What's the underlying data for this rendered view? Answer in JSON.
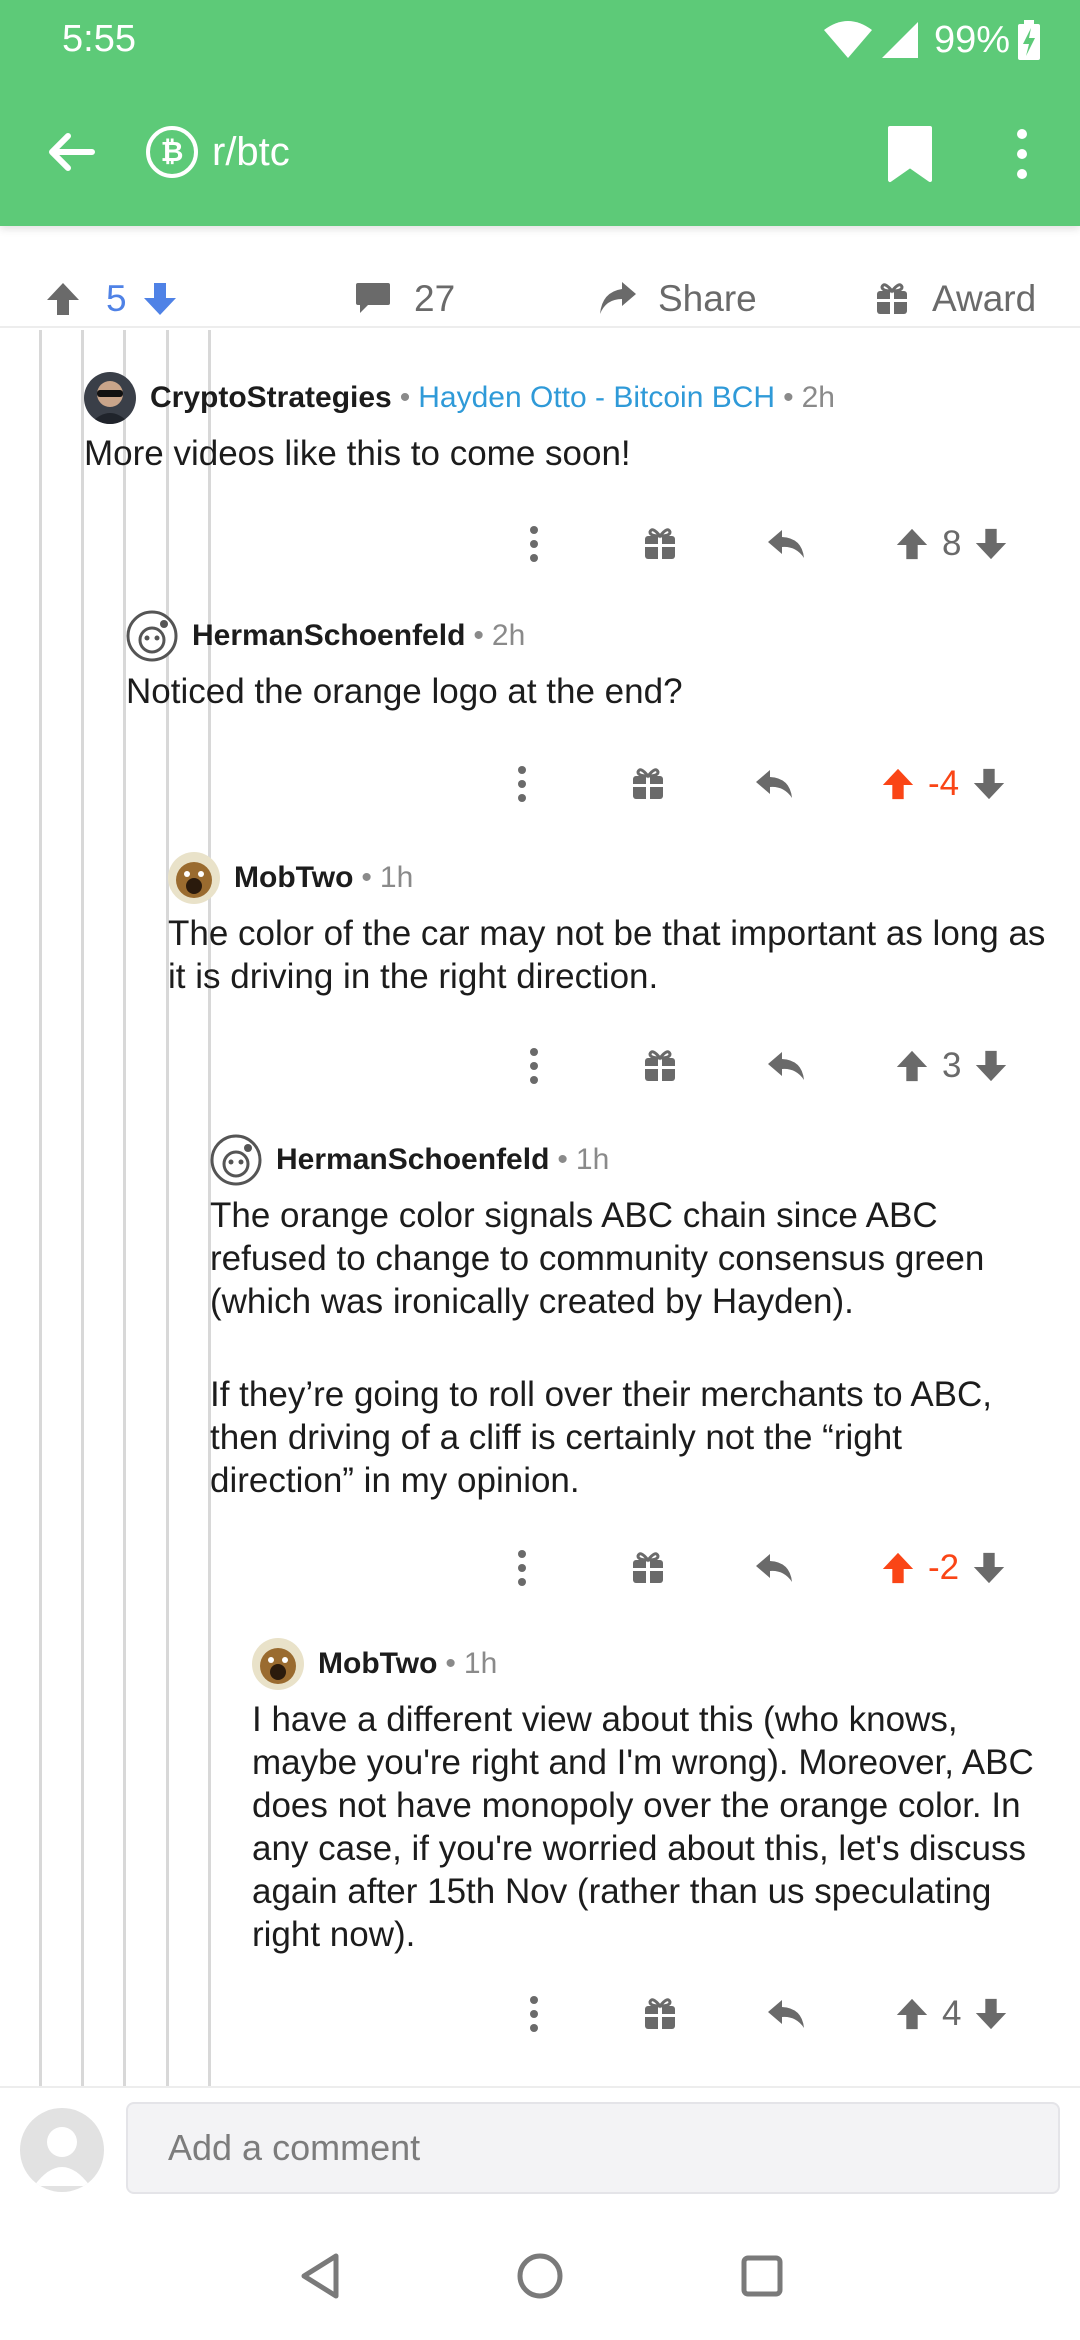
{
  "status_bar": {
    "time": "5:55",
    "battery": "99%"
  },
  "app_bar": {
    "subreddit": "r/btc",
    "subreddit_icon": "bitcoin-icon"
  },
  "post_actions": {
    "score": "5",
    "comment_count": "27",
    "share_label": "Share",
    "award_label": "Award"
  },
  "comments": [
    {
      "author": "CryptoStrategies",
      "flair": "Hayden Otto - Bitcoin BCH",
      "age": "2h",
      "paragraphs": [
        "More videos like this to come soon!"
      ],
      "score": "8",
      "upvoted": false
    },
    {
      "author": "HermanSchoenfeld",
      "flair": "",
      "age": "2h",
      "paragraphs": [
        "Noticed the orange logo at the end?"
      ],
      "score": "-4",
      "upvoted": true
    },
    {
      "author": "MobTwo",
      "flair": "",
      "age": "1h",
      "paragraphs": [
        "The color of the car may not be that important as long as it is driving in the right direction."
      ],
      "score": "3",
      "upvoted": false
    },
    {
      "author": "HermanSchoenfeld",
      "flair": "",
      "age": "1h",
      "paragraphs": [
        "The orange color signals ABC chain since ABC refused to change to community consensus green (which was ironically created by Hayden).",
        "If they’re going to roll over their merchants to ABC, then driving of a cliff is certainly not the “right direction” in my opinion."
      ],
      "score": "-2",
      "upvoted": true
    },
    {
      "author": "MobTwo",
      "flair": "",
      "age": "1h",
      "paragraphs": [
        "I have a different view about this (who knows, maybe you're right and I'm wrong). Moreover, ABC does not have monopoly over the orange color. In any case, if you're worried about this, let's discuss again after 15th Nov (rather than us speculating right now)."
      ],
      "score": "4",
      "upvoted": false
    }
  ],
  "composer": {
    "placeholder": "Add a comment"
  },
  "colors": {
    "brand_green": "#5dca78",
    "upvote_orange": "#fa4516",
    "score_blue": "#4f82e6",
    "flair_blue": "#2f9ad8"
  }
}
